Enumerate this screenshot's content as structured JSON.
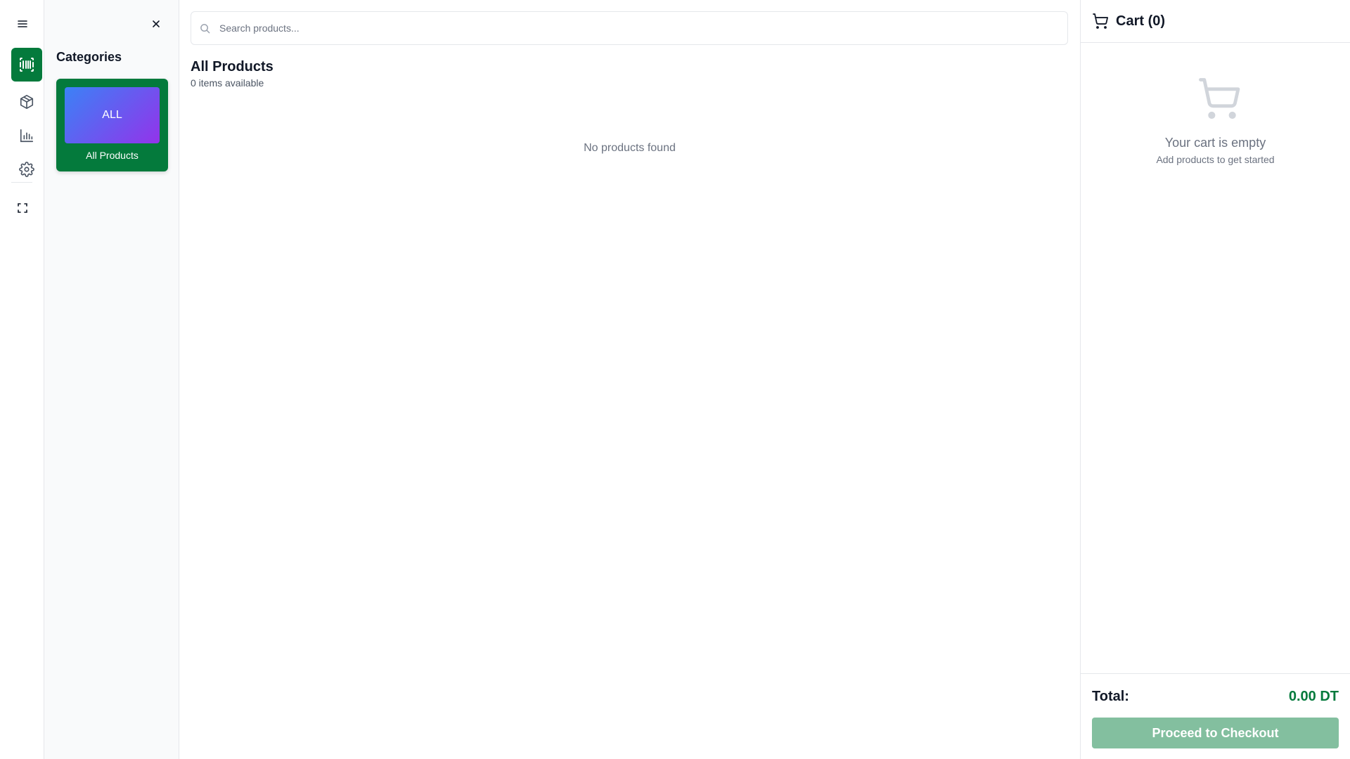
{
  "rail": {
    "accent": "#047a3c",
    "items": [
      {
        "icon": "menu-icon"
      },
      {
        "icon": "barcode-icon",
        "active": true
      },
      {
        "icon": "package-icon"
      },
      {
        "icon": "bar-chart-icon"
      },
      {
        "icon": "gear-icon"
      },
      {
        "icon": "fullscreen-icon"
      }
    ]
  },
  "categories": {
    "close_icon": "close-icon",
    "title": "Categories",
    "items": [
      {
        "thumb_label": "ALL",
        "label": "All Products",
        "selected": true
      }
    ]
  },
  "main": {
    "search_placeholder": "Search products...",
    "search_value": "",
    "title": "All Products",
    "subtitle": "0 items available",
    "empty_message": "No products found"
  },
  "cart": {
    "title": "Cart (0)",
    "empty_title": "Your cart is empty",
    "empty_subtitle": "Add products to get started",
    "total_label": "Total:",
    "total_value": "0.00 DT",
    "checkout_label": "Proceed to Checkout",
    "colors": {
      "total": "#047a3c",
      "checkout_disabled": "#83bf9f"
    }
  }
}
